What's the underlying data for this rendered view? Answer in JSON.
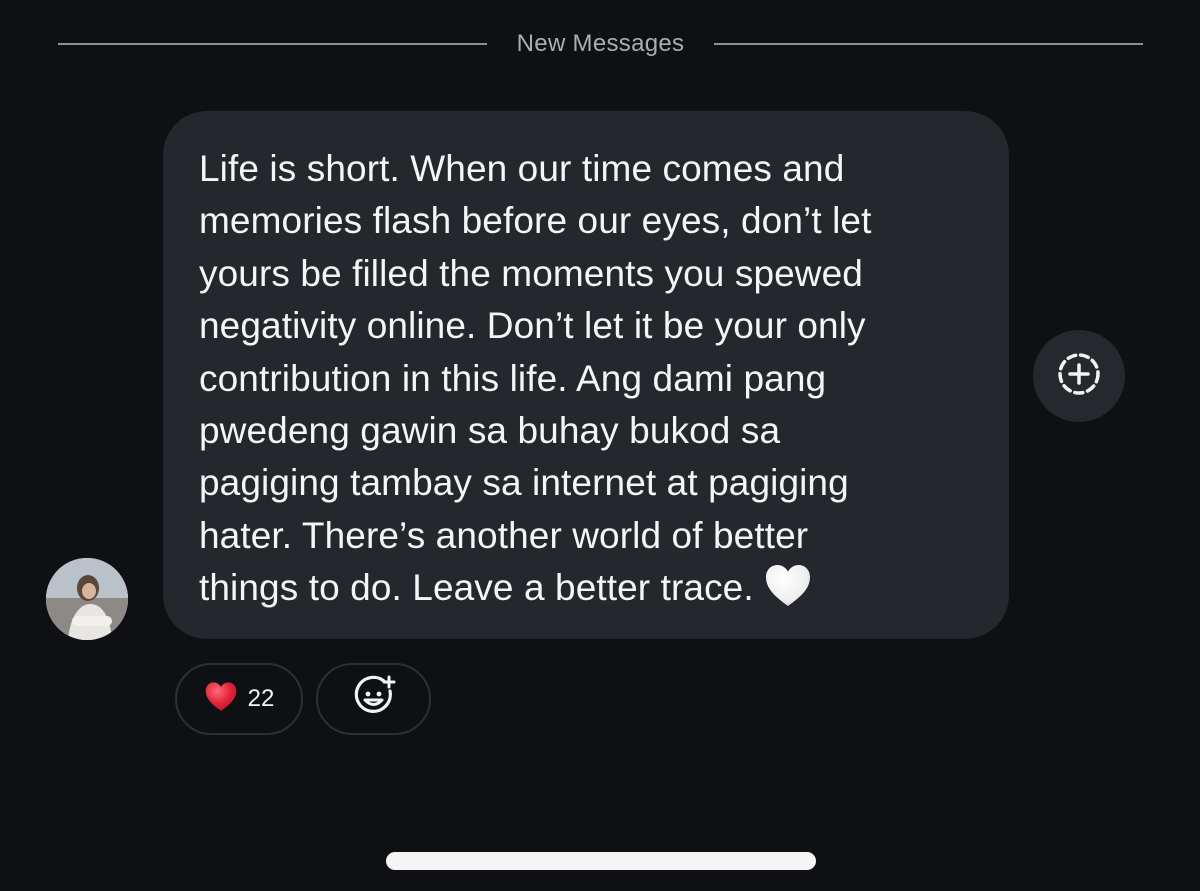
{
  "divider": {
    "label": "New Messages"
  },
  "message": {
    "lines": [
      "Life is short. When our time comes and",
      "memories flash before our eyes, don’t let",
      "yours be filled the moments you spewed",
      "negativity online. Don’t let it be your only",
      "contribution in this life. Ang dami pang",
      "pwedeng gawin sa buhay bukod sa",
      "pagiging tambay sa internet at pagiging",
      "hater. There’s another world of better",
      "things to do. Leave a better trace."
    ],
    "trailing_emoji": "white-heart-icon"
  },
  "side_button": {
    "icon": "add-to-story-icon"
  },
  "reactions": [
    {
      "icon": "red-heart-icon",
      "count": "22"
    },
    {
      "icon": "add-reaction-icon"
    }
  ],
  "colors": {
    "background": "#0e1013",
    "bubble": "#24272b",
    "text": "#f4f5f7",
    "muted": "#a9adb4",
    "heart": "#e0243a"
  }
}
